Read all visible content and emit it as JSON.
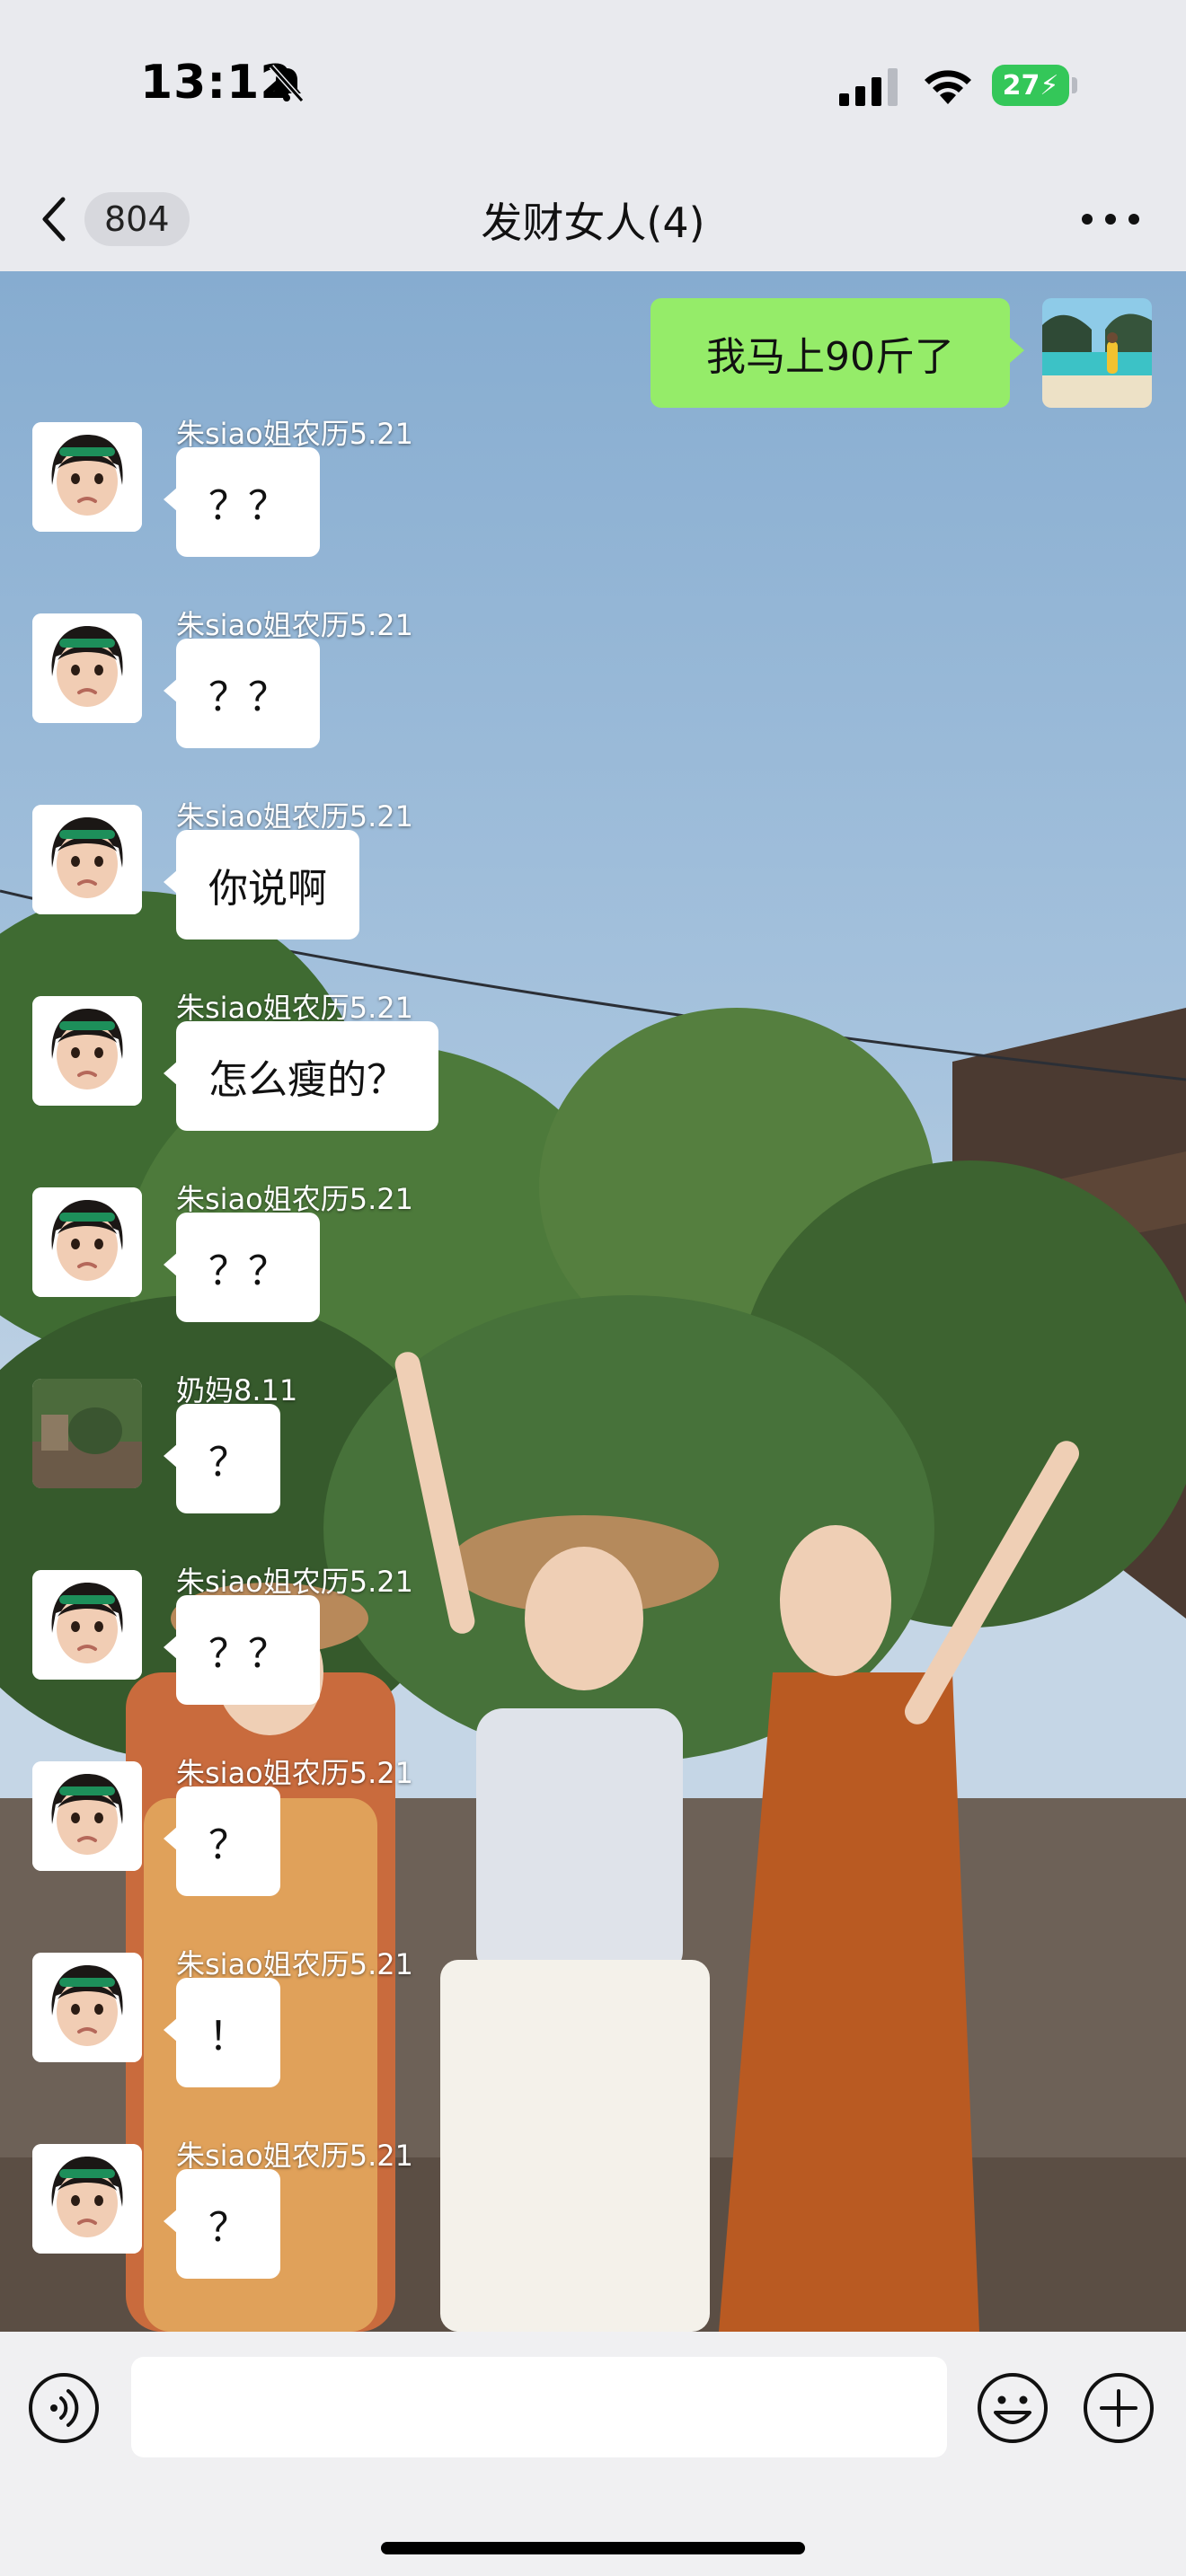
{
  "status_bar": {
    "time": "13:12",
    "battery": "27",
    "icons": [
      "bell-slash-icon",
      "cellular-signal-icon",
      "wifi-icon",
      "battery-charging-icon"
    ]
  },
  "nav": {
    "back_icon": "chevron-left-icon",
    "unread_count": "804",
    "title": "发财女人(4)",
    "more_icon": "more-dots-icon"
  },
  "chat": {
    "self_message": {
      "text": "我马上90斤了"
    },
    "messages": [
      {
        "sender": "朱siao姐农历5.21",
        "text": "？？"
      },
      {
        "sender": "朱siao姐农历5.21",
        "text": "？？"
      },
      {
        "sender": "朱siao姐农历5.21",
        "text": "你说啊"
      },
      {
        "sender": "朱siao姐农历5.21",
        "text": "怎么瘦的？"
      },
      {
        "sender": "朱siao姐农历5.21",
        "text": "？？"
      },
      {
        "sender": "奶妈8.11",
        "text": "？"
      },
      {
        "sender": "朱siao姐农历5.21",
        "text": "？？"
      },
      {
        "sender": "朱siao姐农历5.21",
        "text": "？"
      },
      {
        "sender": "朱siao姐农历5.21",
        "text": "！"
      },
      {
        "sender": "朱siao姐农历5.21",
        "text": "？"
      }
    ]
  },
  "input_bar": {
    "placeholder": "",
    "icons": [
      "voice-icon",
      "emoji-icon",
      "plus-icon"
    ]
  },
  "colors": {
    "self_bubble": "#95ec69",
    "other_bubble": "#ffffff",
    "bar_background": "#e9eaee"
  }
}
